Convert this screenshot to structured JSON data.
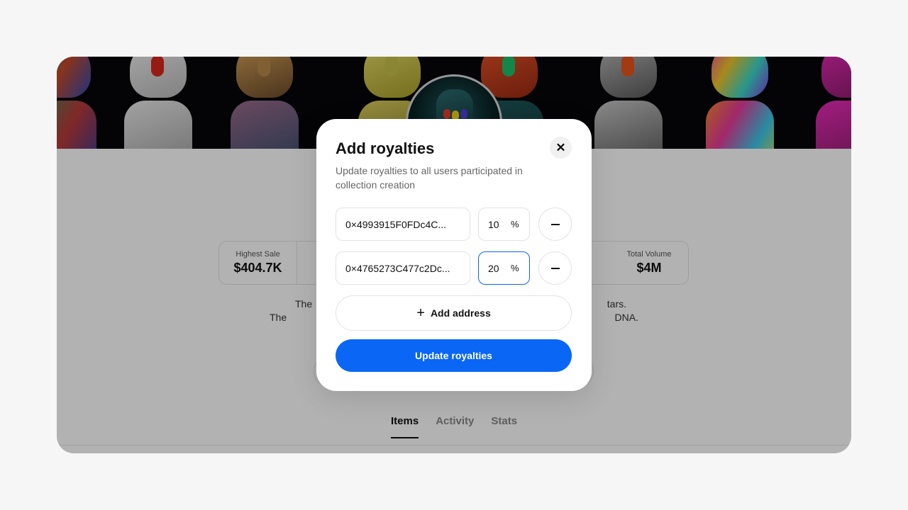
{
  "collection": {
    "stats": [
      {
        "label": "Highest Sale",
        "value": "$404.7K"
      },
      {
        "label": "",
        "value": "$"
      },
      {
        "label": "Total Volume",
        "value": "$4M"
      }
    ],
    "description_line1": "The",
    "description_line1_end": "tars.",
    "description_line2": "The",
    "description_line2_end": "DNA.",
    "tabs": [
      "Items",
      "Activity",
      "Stats"
    ],
    "active_tab": "Items"
  },
  "modal": {
    "title": "Add royalties",
    "subtitle": "Update royalties to all users participated in collection creation",
    "close_icon": "close-icon",
    "rows": [
      {
        "address": "0×4993915F0FDc4C...",
        "percent": "10",
        "unit": "%"
      },
      {
        "address": "0×4765273C477c2Dc...",
        "percent": "20",
        "unit": "%"
      }
    ],
    "add_address_label": "Add address",
    "update_label": "Update royalties"
  },
  "colors": {
    "accent": "#0a66f5",
    "overlay": "rgba(0,0,0,0.30)"
  }
}
